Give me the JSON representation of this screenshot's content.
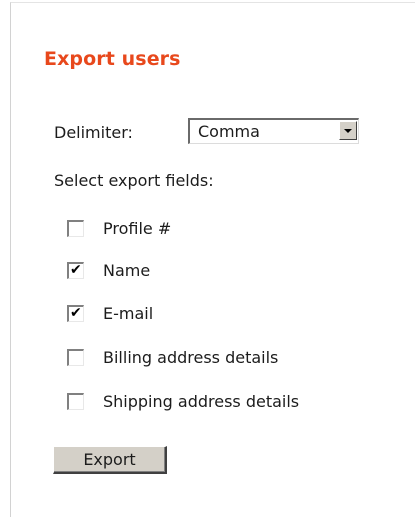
{
  "title": "Export users",
  "delimiter": {
    "label": "Delimiter:",
    "selected": "Comma"
  },
  "fields_label": "Select export fields:",
  "fields": [
    {
      "label": "Profile #",
      "checked": false
    },
    {
      "label": "Name",
      "checked": true
    },
    {
      "label": "E-mail",
      "checked": true
    },
    {
      "label": "Billing address details",
      "checked": false
    },
    {
      "label": "Shipping address details",
      "checked": false
    }
  ],
  "export_button": "Export",
  "colors": {
    "title": "#e8481c",
    "button_face": "#d4d0c8"
  }
}
